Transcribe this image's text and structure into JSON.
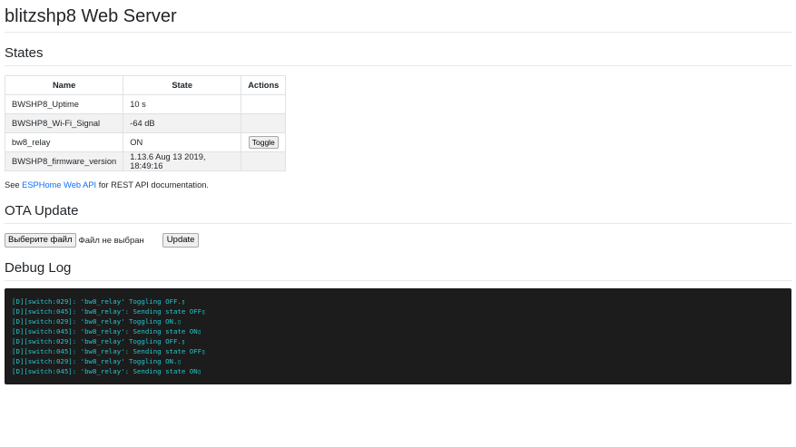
{
  "page": {
    "title": "blitzshp8 Web Server"
  },
  "states": {
    "heading": "States",
    "columns": [
      "Name",
      "State",
      "Actions"
    ],
    "rows": [
      {
        "name": "BWSHP8_Uptime",
        "state": "10 s",
        "action": ""
      },
      {
        "name": "BWSHP8_Wi-Fi_Signal",
        "state": "-64 dB",
        "action": ""
      },
      {
        "name": "bw8_relay",
        "state": "ON",
        "action": "Toggle"
      },
      {
        "name": "BWSHP8_firmware_version",
        "state": "1.13.6 Aug 13 2019, 18:49:16",
        "action": ""
      }
    ],
    "api_prefix": "See",
    "api_link": "ESPHome Web API",
    "api_suffix": "for REST API documentation."
  },
  "ota": {
    "heading": "OTA Update",
    "choose_file_label": "Выберите файл",
    "file_status": "Файл не выбран",
    "update_label": "Update"
  },
  "debug": {
    "heading": "Debug Log",
    "lines": [
      "[D][switch:029]: 'bw8_relay' Toggling OFF.▯",
      "[D][switch:045]: 'bw8_relay': Sending state OFF▯",
      "[D][switch:029]: 'bw8_relay' Toggling ON.▯",
      "[D][switch:045]: 'bw8_relay': Sending state ON▯",
      "[D][switch:029]: 'bw8_relay' Toggling OFF.▯",
      "[D][switch:045]: 'bw8_relay': Sending state OFF▯",
      "[D][switch:029]: 'bw8_relay' Toggling ON.▯",
      "[D][switch:045]: 'bw8_relay': Sending state ON▯"
    ]
  },
  "colors": {
    "link": "#0d6efd",
    "log_bg": "#1c1c1c",
    "log_text": "#25c6ce"
  }
}
